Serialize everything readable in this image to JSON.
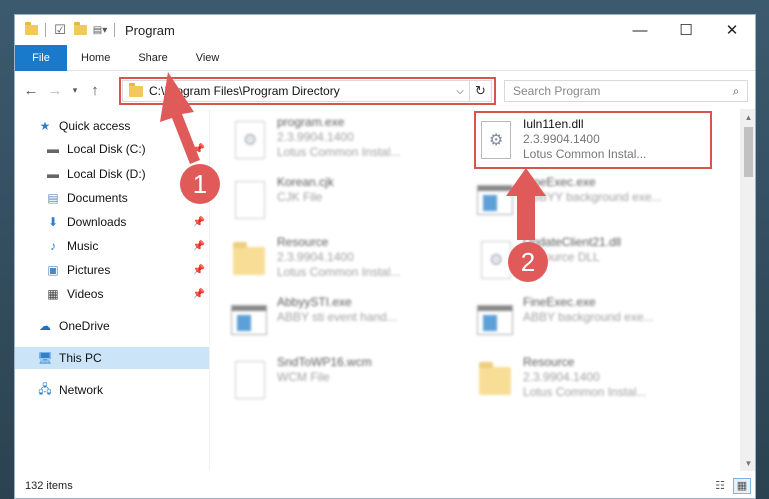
{
  "window": {
    "title": "Program",
    "controls": {
      "minimize": "—",
      "maximize": "☐",
      "close": "✕"
    }
  },
  "ribbon": {
    "tabs": [
      {
        "label": "File"
      },
      {
        "label": "Home"
      },
      {
        "label": "Share"
      },
      {
        "label": "View"
      }
    ]
  },
  "address": {
    "path": "C:\\Program Files\\Program Directory"
  },
  "search": {
    "placeholder": "Search Program"
  },
  "sidebar": {
    "items": [
      {
        "label": "Quick access"
      },
      {
        "label": "Local Disk (C:)"
      },
      {
        "label": "Local Disk (D:)"
      },
      {
        "label": "Documents"
      },
      {
        "label": "Downloads"
      },
      {
        "label": "Music"
      },
      {
        "label": "Pictures"
      },
      {
        "label": "Videos"
      },
      {
        "label": "OneDrive"
      },
      {
        "label": "This PC"
      },
      {
        "label": "Network"
      }
    ]
  },
  "files": [
    {
      "name": "program.exe",
      "line2": "2.3.9904.1400",
      "line3": "Lotus Common Instal..."
    },
    {
      "name": "Iuln11en.dll",
      "line2": "2.3.9904.1400",
      "line3": "Lotus Common Instal..."
    },
    {
      "name": "Korean.cjk",
      "line2": "CJK File",
      "line3": ""
    },
    {
      "name": "FineExec.exe",
      "line2": "ABBYY background exe...",
      "line3": ""
    },
    {
      "name": "Resource",
      "line2": "2.3.9904.1400",
      "line3": "Lotus Common Instal..."
    },
    {
      "name": "UpdateClient21.dll",
      "line2": "Resource DLL",
      "line3": ""
    },
    {
      "name": "AbbyySTI.exe",
      "line2": "ABBY sti event hand...",
      "line3": ""
    },
    {
      "name": "FineExec.exe",
      "line2": "ABBY background exe...",
      "line3": ""
    },
    {
      "name": "SndToWP16.wcm",
      "line2": "WCM File",
      "line3": ""
    },
    {
      "name": "Resource",
      "line2": "2.3.9904.1400",
      "line3": "Lotus Common Instal..."
    }
  ],
  "status": {
    "item_count": "132 items"
  },
  "annotations": {
    "badge1": "1",
    "badge2": "2",
    "color": "#e05a5a"
  }
}
